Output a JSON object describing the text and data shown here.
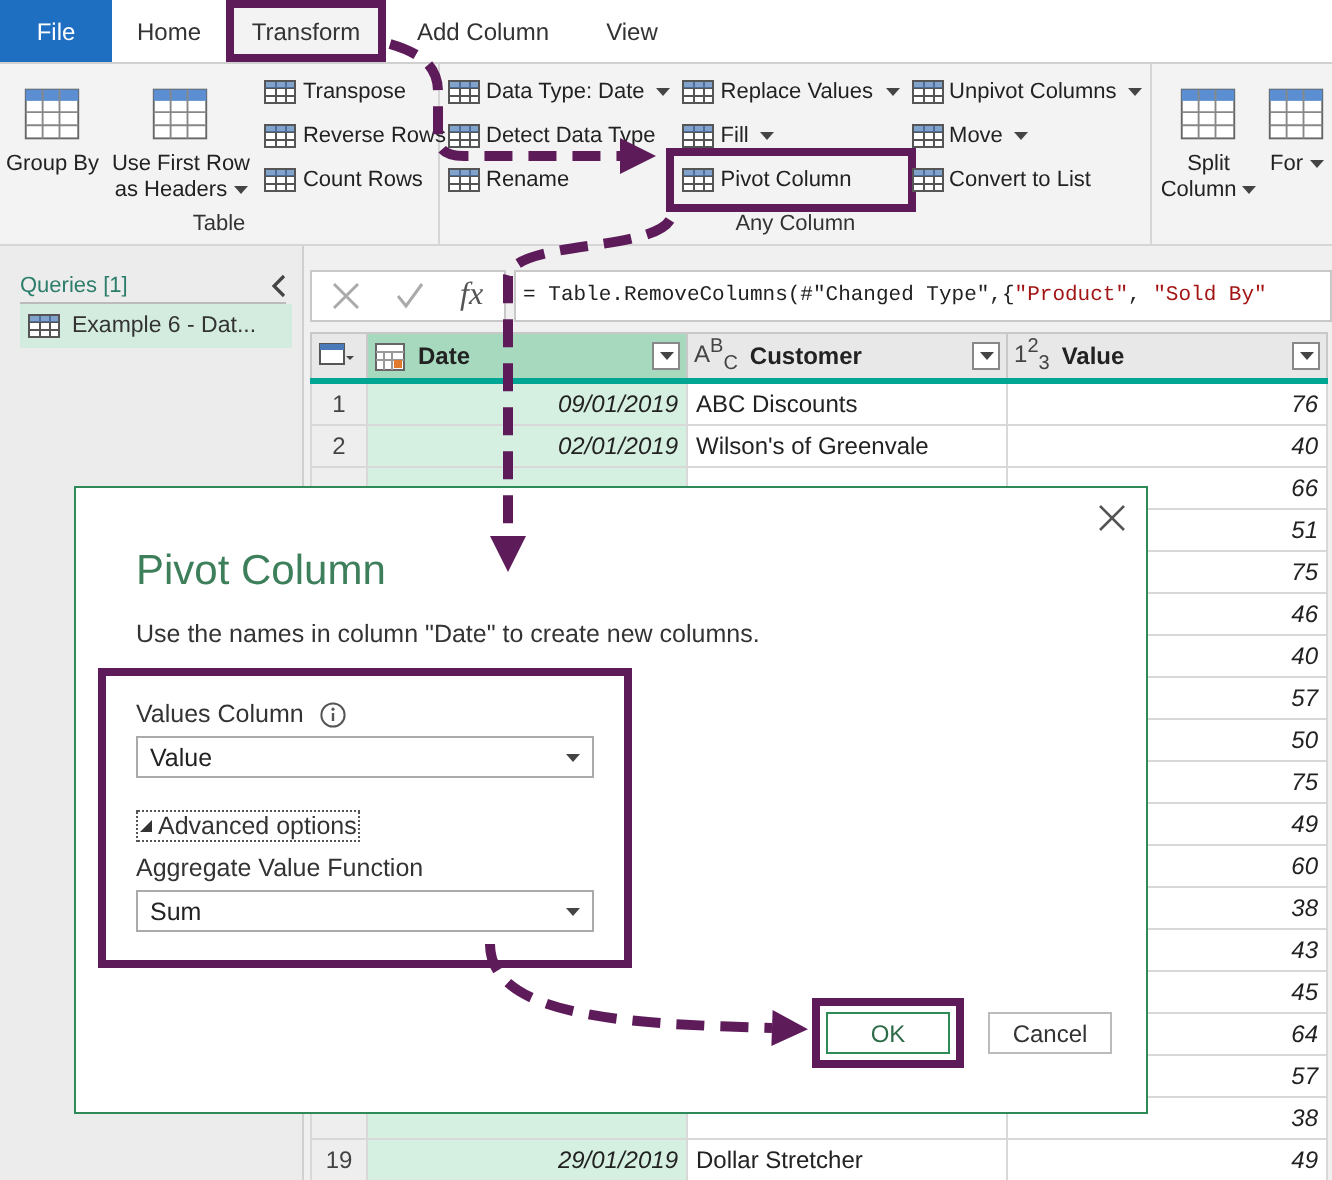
{
  "ribbon_tabs": [
    {
      "label": "File",
      "kind": "file",
      "selected": false,
      "highlighted": false
    },
    {
      "label": "Home",
      "kind": "tab",
      "selected": false,
      "highlighted": false
    },
    {
      "label": "Transform",
      "kind": "tab",
      "selected": true,
      "highlighted": true
    },
    {
      "label": "Add Column",
      "kind": "tab",
      "selected": false,
      "highlighted": false
    },
    {
      "label": "View",
      "kind": "tab",
      "selected": false,
      "highlighted": false
    }
  ],
  "ribbon_groups": [
    {
      "label": "Table",
      "items": [
        {
          "label": "Group By",
          "kind": "large",
          "dropdown": false
        },
        {
          "label": "Use First Row as Headers",
          "kind": "large",
          "dropdown": true
        },
        {
          "label": "Transpose",
          "kind": "small",
          "dropdown": false
        },
        {
          "label": "Reverse Rows",
          "kind": "small",
          "dropdown": false
        },
        {
          "label": "Count Rows",
          "kind": "small",
          "dropdown": false
        }
      ]
    },
    {
      "label": "Any Column",
      "items": [
        {
          "label": "Data Type: Date",
          "kind": "small",
          "dropdown": true
        },
        {
          "label": "Detect Data Type",
          "kind": "small",
          "dropdown": false
        },
        {
          "label": "Rename",
          "kind": "small",
          "dropdown": false
        },
        {
          "label": "Replace Values",
          "kind": "small",
          "dropdown": true
        },
        {
          "label": "Fill",
          "kind": "small",
          "dropdown": true
        },
        {
          "label": "Pivot Column",
          "kind": "small",
          "dropdown": false,
          "highlighted": true
        },
        {
          "label": "Unpivot Columns",
          "kind": "small",
          "dropdown": true
        },
        {
          "label": "Move",
          "kind": "small",
          "dropdown": true
        },
        {
          "label": "Convert to List",
          "kind": "small",
          "dropdown": false
        }
      ]
    },
    {
      "items": [
        {
          "label": "Split Column",
          "kind": "large",
          "dropdown": true
        },
        {
          "label": "For",
          "kind": "large",
          "dropdown": true
        }
      ]
    }
  ],
  "queries": {
    "title": "Queries [1]",
    "items": [
      {
        "label": "Example 6 - Dat...",
        "selected": true
      }
    ]
  },
  "formula": {
    "fx": "fx",
    "parts": [
      {
        "text": "= Table.RemoveColumns(#\"Changed Type\",{",
        "kind": "code"
      },
      {
        "text": "\"Product\"",
        "kind": "string"
      },
      {
        "text": ", ",
        "kind": "code"
      },
      {
        "text": "\"Sold By\"",
        "kind": "string"
      }
    ]
  },
  "table": {
    "columns": [
      {
        "name": "Date",
        "kind": "date",
        "selected": true
      },
      {
        "name": "Customer",
        "kind": "text",
        "type_label": "A$^{B}$$_{C}$",
        "selected": false
      },
      {
        "name": "Value",
        "kind": "text",
        "type_label": "1$^{2}$$_{3}$",
        "selected": false
      }
    ],
    "rows": [
      {
        "n": "1",
        "date": "09/01/2019",
        "customer": "ABC Discounts",
        "value": "76"
      },
      {
        "n": "2",
        "date": "02/01/2019",
        "customer": "Wilson's of Greenvale",
        "value": "40"
      },
      {
        "value": "66"
      },
      {
        "value": "51"
      },
      {
        "value": "75"
      },
      {
        "value": "46"
      },
      {
        "value": "40"
      },
      {
        "value": "57"
      },
      {
        "value": "50"
      },
      {
        "value": "75"
      },
      {
        "value": "49"
      },
      {
        "value": "60"
      },
      {
        "value": "38"
      },
      {
        "value": "43"
      },
      {
        "value": "45"
      },
      {
        "value": "64"
      },
      {
        "value": "57"
      },
      {
        "value": "38"
      },
      {
        "n": "19",
        "date": "29/01/2019",
        "customer": "Dollar Stretcher",
        "value": "49"
      }
    ]
  },
  "dialog": {
    "title": "Pivot Column",
    "description": "Use the names in column \"Date\" to create new columns.",
    "options_highlighted": true,
    "values_label": "Values Column",
    "values_value": "Value",
    "advanced": "Advanced options",
    "expanded": true,
    "aggregate_label": "Aggregate Value Function",
    "aggregate_value": "Sum",
    "buttons": [
      {
        "label": "OK",
        "kind": "primary",
        "highlighted": true
      },
      {
        "label": "Cancel",
        "kind": "secondary",
        "highlighted": false
      }
    ]
  }
}
